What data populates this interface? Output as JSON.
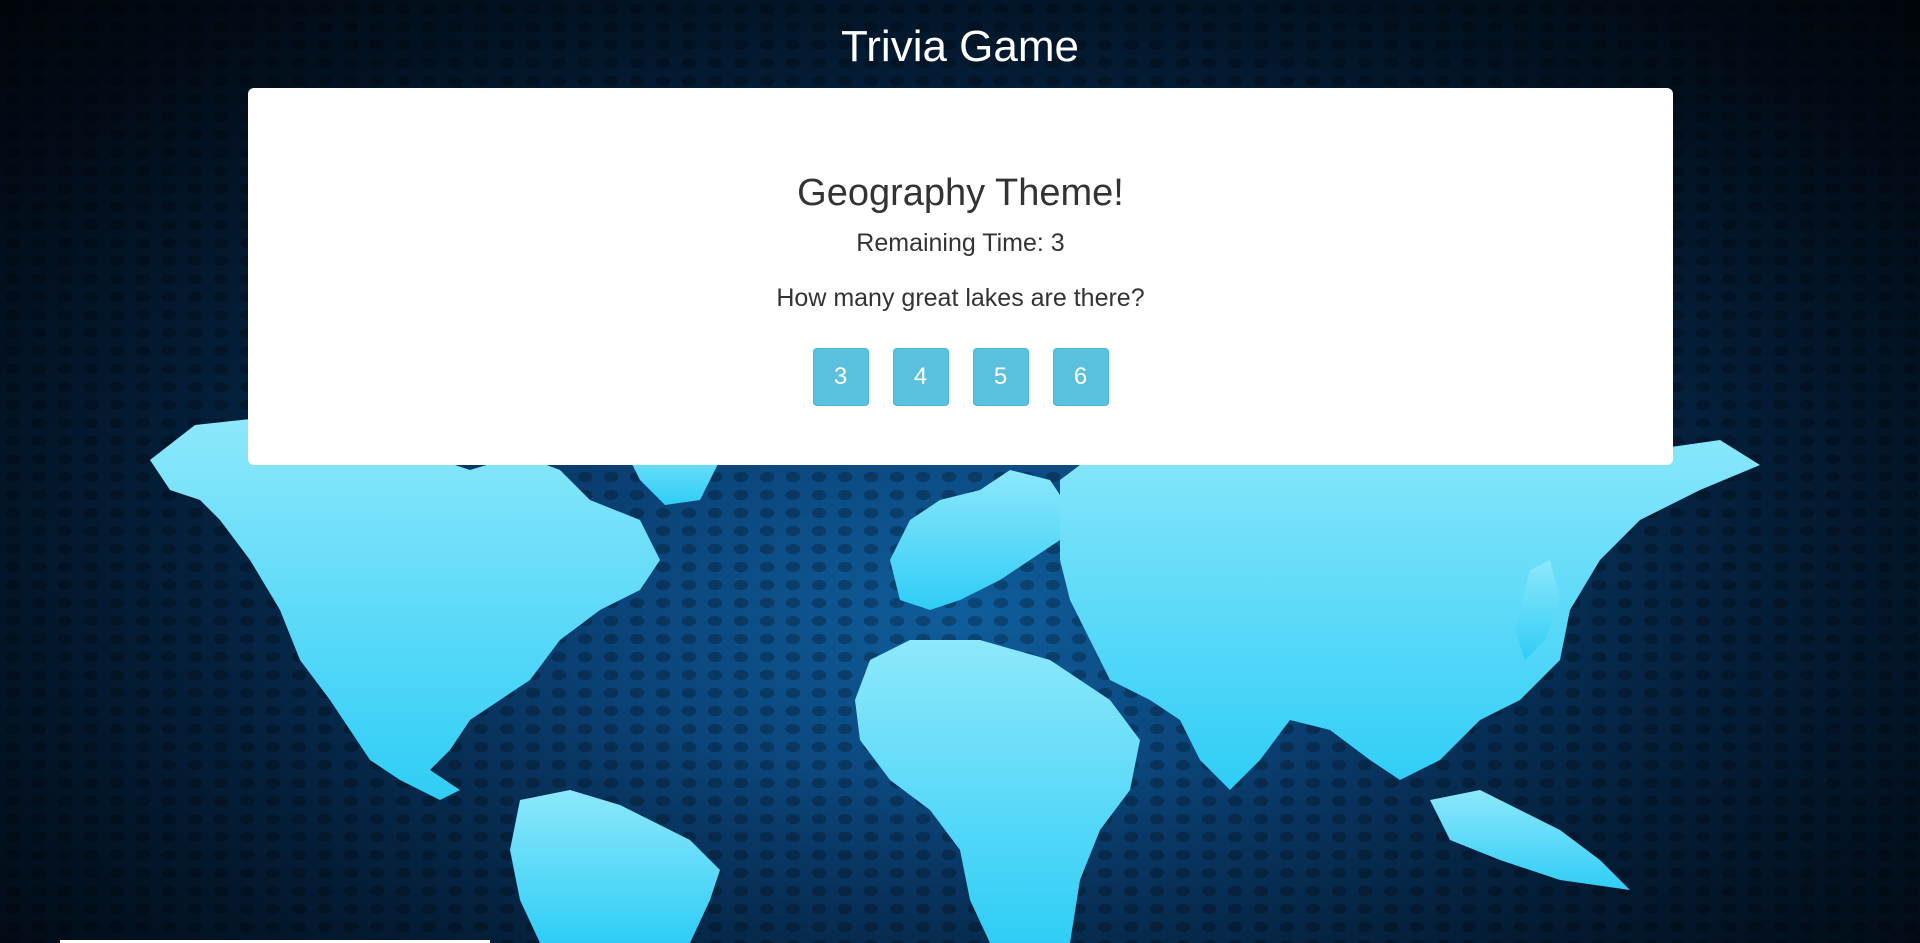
{
  "page": {
    "title": "Trivia Game"
  },
  "game": {
    "theme_heading": "Geography Theme!",
    "timer_label": "Remaining Time: 3",
    "question": "How many great lakes are there?",
    "answers": [
      "3",
      "4",
      "5",
      "6"
    ]
  },
  "colors": {
    "answer_button": "#5bc0de",
    "card_background": "#ffffff",
    "continent_fill": "#5fd6f5",
    "ocean": "#0a3f72"
  },
  "icons": {
    "background": "world-map"
  }
}
